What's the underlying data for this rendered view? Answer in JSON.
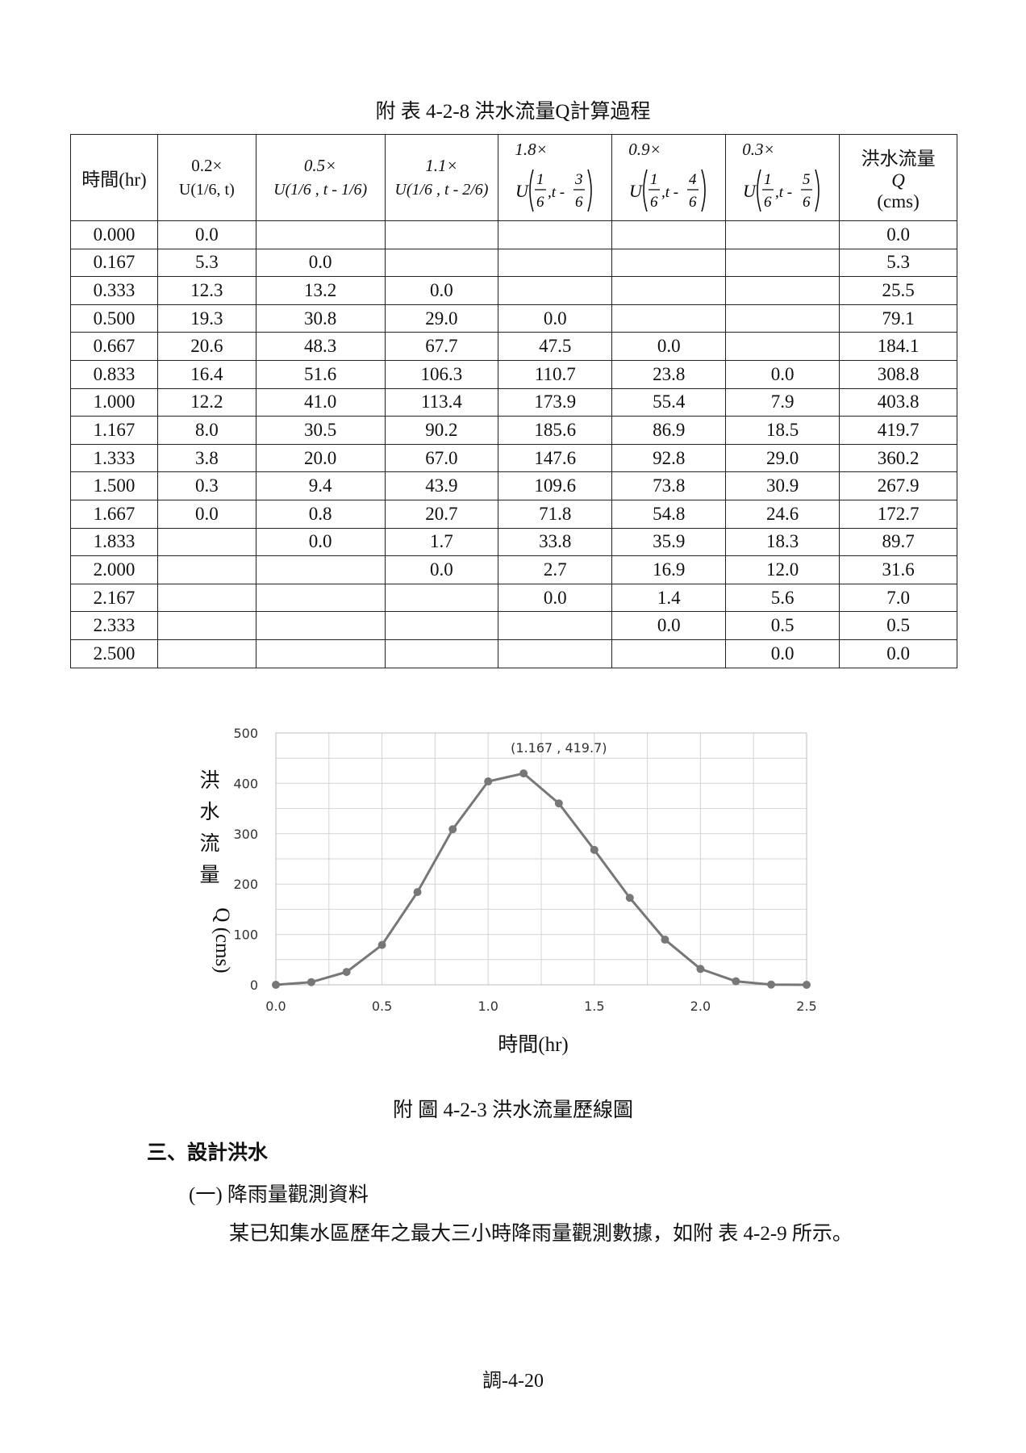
{
  "table": {
    "caption": "附 表 4-2-8 洪水流量Q計算過程",
    "headers": {
      "time": "時間(hr)",
      "c1_coef": "0.2×",
      "c1_fn": "U(1/6, t)",
      "c2_coef": "0.5×",
      "c2_fn": "U(1/6 , t - 1/6)",
      "c3_coef": "1.1×",
      "c3_fn": "U(1/6 , t - 2/6)",
      "c4_coef": "1.8×",
      "c5_coef": "0.9×",
      "c6_coef": "0.3×",
      "q_line1": "洪水流量",
      "q_line2": "Q",
      "q_line3": "(cms)"
    },
    "rows": [
      [
        "0.000",
        "0.0",
        "",
        "",
        "",
        "",
        "",
        "0.0"
      ],
      [
        "0.167",
        "5.3",
        "0.0",
        "",
        "",
        "",
        "",
        "5.3"
      ],
      [
        "0.333",
        "12.3",
        "13.2",
        "0.0",
        "",
        "",
        "",
        "25.5"
      ],
      [
        "0.500",
        "19.3",
        "30.8",
        "29.0",
        "0.0",
        "",
        "",
        "79.1"
      ],
      [
        "0.667",
        "20.6",
        "48.3",
        "67.7",
        "47.5",
        "0.0",
        "",
        "184.1"
      ],
      [
        "0.833",
        "16.4",
        "51.6",
        "106.3",
        "110.7",
        "23.8",
        "0.0",
        "308.8"
      ],
      [
        "1.000",
        "12.2",
        "41.0",
        "113.4",
        "173.9",
        "55.4",
        "7.9",
        "403.8"
      ],
      [
        "1.167",
        "8.0",
        "30.5",
        "90.2",
        "185.6",
        "86.9",
        "18.5",
        "419.7"
      ],
      [
        "1.333",
        "3.8",
        "20.0",
        "67.0",
        "147.6",
        "92.8",
        "29.0",
        "360.2"
      ],
      [
        "1.500",
        "0.3",
        "9.4",
        "43.9",
        "109.6",
        "73.8",
        "30.9",
        "267.9"
      ],
      [
        "1.667",
        "0.0",
        "0.8",
        "20.7",
        "71.8",
        "54.8",
        "24.6",
        "172.7"
      ],
      [
        "1.833",
        "",
        "0.0",
        "1.7",
        "33.8",
        "35.9",
        "18.3",
        "89.7"
      ],
      [
        "2.000",
        "",
        "",
        "0.0",
        "2.7",
        "16.9",
        "12.0",
        "31.6"
      ],
      [
        "2.167",
        "",
        "",
        "",
        "0.0",
        "1.4",
        "5.6",
        "7.0"
      ],
      [
        "2.333",
        "",
        "",
        "",
        "",
        "0.0",
        "0.5",
        "0.5"
      ],
      [
        "2.500",
        "",
        "",
        "",
        "",
        "",
        "0.0",
        "0.0"
      ]
    ],
    "peak_row_index": 7
  },
  "chart_data": {
    "type": "line",
    "x": [
      0.0,
      0.167,
      0.333,
      0.5,
      0.667,
      0.833,
      1.0,
      1.167,
      1.333,
      1.5,
      1.667,
      1.833,
      2.0,
      2.167,
      2.333,
      2.5
    ],
    "series": [
      {
        "values": [
          0.0,
          5.3,
          25.5,
          79.1,
          184.1,
          308.8,
          403.8,
          419.7,
          360.2,
          267.9,
          172.7,
          89.7,
          31.6,
          7.0,
          0.5,
          0.0
        ],
        "color": "#777777"
      }
    ],
    "xlabel": "時間(hr)",
    "ylabel_chars": [
      "洪",
      "水",
      "流",
      "量"
    ],
    "ylabel_tail": "Q (cms)",
    "xlim": [
      0,
      2.5
    ],
    "ylim": [
      0,
      500
    ],
    "xticks": [
      "0.0",
      "0.5",
      "1.0",
      "1.5",
      "2.0",
      "2.5"
    ],
    "yticks": [
      "0",
      "100",
      "200",
      "300",
      "400",
      "500"
    ],
    "grid": true,
    "annotation": "(1.167 , 419.7)"
  },
  "figure": {
    "caption": "附 圖 4-2-3 洪水流量歷線圖"
  },
  "section": {
    "heading": "三、設計洪水",
    "subheading": "(一) 降雨量觀測資料",
    "paragraph": "某已知集水區歷年之最大三小時降雨量觀測數據，如附 表 4-2-9 所示。"
  },
  "page_number": "調-4-20"
}
